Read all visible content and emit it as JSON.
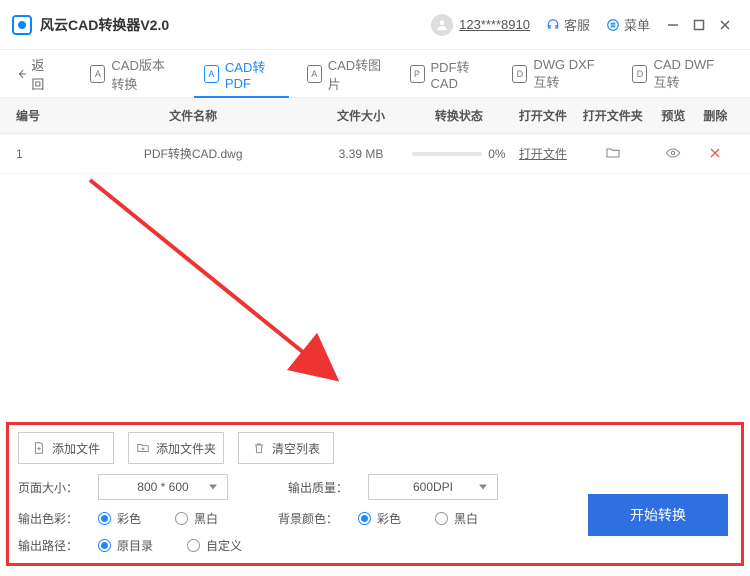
{
  "window": {
    "title": "风云CAD转换器V2.0",
    "username": "123****8910",
    "customer_service": "客服",
    "menu": "菜单"
  },
  "back_label": "返回",
  "tabs": [
    {
      "label": "CAD版本转换"
    },
    {
      "label": "CAD转PDF"
    },
    {
      "label": "CAD转图片"
    },
    {
      "label": "PDF转CAD"
    },
    {
      "label": "DWG DXF互转"
    },
    {
      "label": "CAD DWF互转"
    }
  ],
  "columns": {
    "idx": "编号",
    "name": "文件名称",
    "size": "文件大小",
    "status": "转换状态",
    "open": "打开文件",
    "openf": "打开文件夹",
    "preview": "预览",
    "delete": "删除"
  },
  "rows": [
    {
      "idx": "1",
      "name": "PDF转换CAD.dwg",
      "size": "3.39 MB",
      "status": "0%",
      "open": "打开文件"
    }
  ],
  "bottom": {
    "add_file": "添加文件",
    "add_folder": "添加文件夹",
    "clear_list": "清空列表",
    "page_size_label": "页面大小：",
    "page_size_value": "800 * 600",
    "output_quality_label": "输出质量：",
    "output_quality_value": "600DPI",
    "output_color_label": "输出色彩：",
    "color_opt_color": "彩色",
    "color_opt_bw": "黑白",
    "bg_color_label": "背景颜色：",
    "output_path_label": "输出路径：",
    "path_opt_src": "原目录",
    "path_opt_custom": "自定义",
    "start": "开始转换"
  }
}
